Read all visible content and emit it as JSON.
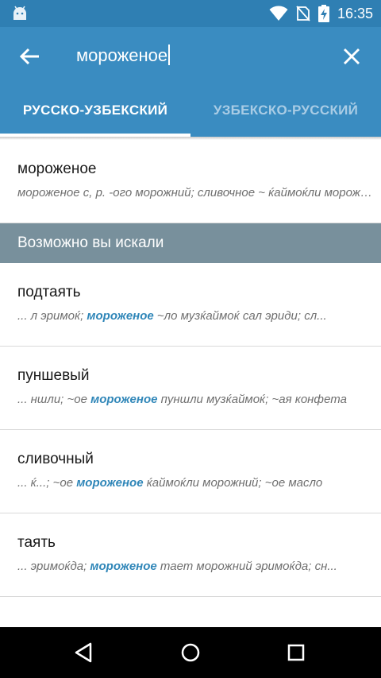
{
  "status_bar": {
    "time": "16:35",
    "icons": [
      "android-icon",
      "wifi-icon",
      "no-sim-icon",
      "battery-charging-icon"
    ]
  },
  "toolbar": {
    "search_value": "мороженое",
    "back_icon": "arrow-left-icon",
    "clear_icon": "close-icon"
  },
  "tabs": [
    {
      "label": "РУССКО-УЗБЕКСКИЙ",
      "active": true
    },
    {
      "label": "УЗБЕКСКО-РУССКИЙ",
      "active": false
    }
  ],
  "main_entry": {
    "word": "мороженое",
    "definition": "мороженое с, р. -ого морожний; сливочное ~ ќаймоќли морожний"
  },
  "suggestions_header": "Возможно вы искали",
  "suggestions": [
    {
      "word": "подтаять",
      "pre": "... л эримоќ; ",
      "highlight": "мороженое",
      "post": " ~ло музќаймоќ сал эриди; сл..."
    },
    {
      "word": "пуншевый",
      "pre": "... ншли; ~ое ",
      "highlight": "мороженое",
      "post": " пуншли музќаймоќ; ~ая конфета"
    },
    {
      "word": "сливочный",
      "pre": "... ќ...; ~ое ",
      "highlight": "мороженое",
      "post": "  ќаймоќли  морожний; ~ое масло"
    },
    {
      "word": "таять",
      "pre": "... эримоќда; ",
      "highlight": "мороженое",
      "post": " тает морожний эримоќда; сн..."
    }
  ],
  "nav_bar": {
    "icons": [
      "back-triangle-icon",
      "home-circle-icon",
      "recents-square-icon"
    ]
  }
}
